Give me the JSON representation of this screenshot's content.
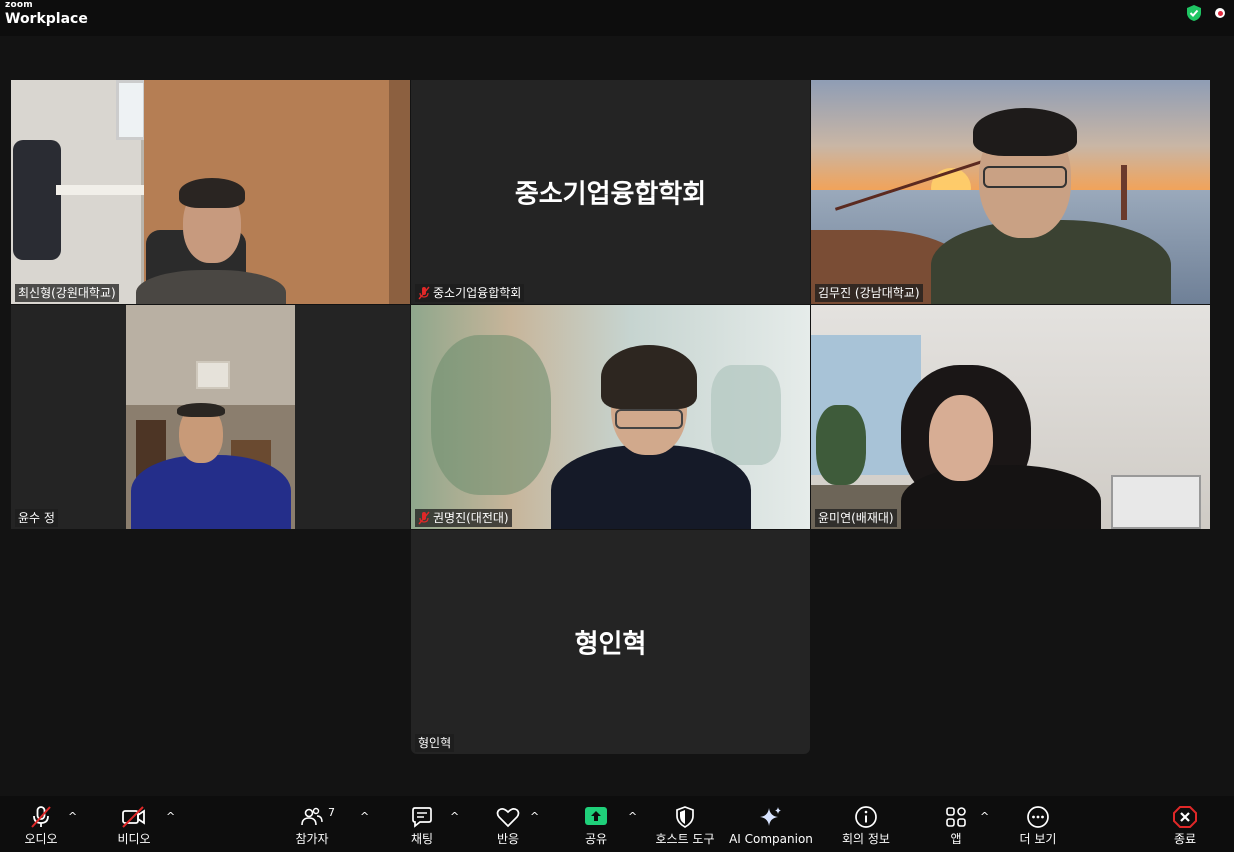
{
  "app": {
    "brand_small": "zoom",
    "brand_large": "Workplace"
  },
  "tiles": [
    {
      "name": "최신형(강원대학교)",
      "muted": false,
      "video": true,
      "speaking": false
    },
    {
      "name": "중소기업융합학회",
      "muted": true,
      "video": false,
      "center_text": "중소기업융합학회",
      "speaking": false
    },
    {
      "name": "김무진 (강남대학교)",
      "muted": false,
      "video": true,
      "speaking": false
    },
    {
      "name": "윤수 정",
      "muted": false,
      "video": true,
      "speaking": false
    },
    {
      "name": "권명진(대전대)",
      "muted": true,
      "video": true,
      "speaking": false
    },
    {
      "name": "윤미연(배재대)",
      "muted": false,
      "video": true,
      "speaking": true
    },
    {
      "name": "형인혁",
      "muted": false,
      "video": false,
      "center_text": "형인혁",
      "speaking": false
    }
  ],
  "toolbar": {
    "audio": {
      "label": "오디오",
      "icon": "mic-muted-icon"
    },
    "video": {
      "label": "비디오",
      "icon": "camera-off-icon"
    },
    "participants": {
      "label": "참가자",
      "count": "7",
      "icon": "people-icon"
    },
    "chat": {
      "label": "채팅",
      "icon": "chat-icon"
    },
    "reactions": {
      "label": "반응",
      "icon": "heart-icon"
    },
    "share": {
      "label": "공유",
      "icon": "share-icon",
      "color": "#1fd07a"
    },
    "host_tools": {
      "label": "호스트 도구",
      "icon": "shield-icon"
    },
    "ai_companion": {
      "label": "AI Companion",
      "icon": "sparkle-icon"
    },
    "meeting_info": {
      "label": "회의 정보",
      "icon": "info-icon"
    },
    "apps": {
      "label": "앱",
      "icon": "apps-icon"
    },
    "more": {
      "label": "더 보기",
      "icon": "more-icon"
    },
    "end": {
      "label": "종료",
      "icon": "end-icon",
      "color": "#e02828"
    }
  },
  "colors": {
    "speaking_border": "#22d17a",
    "security_shield": "#1fc563",
    "mute_red": "#e02828"
  }
}
